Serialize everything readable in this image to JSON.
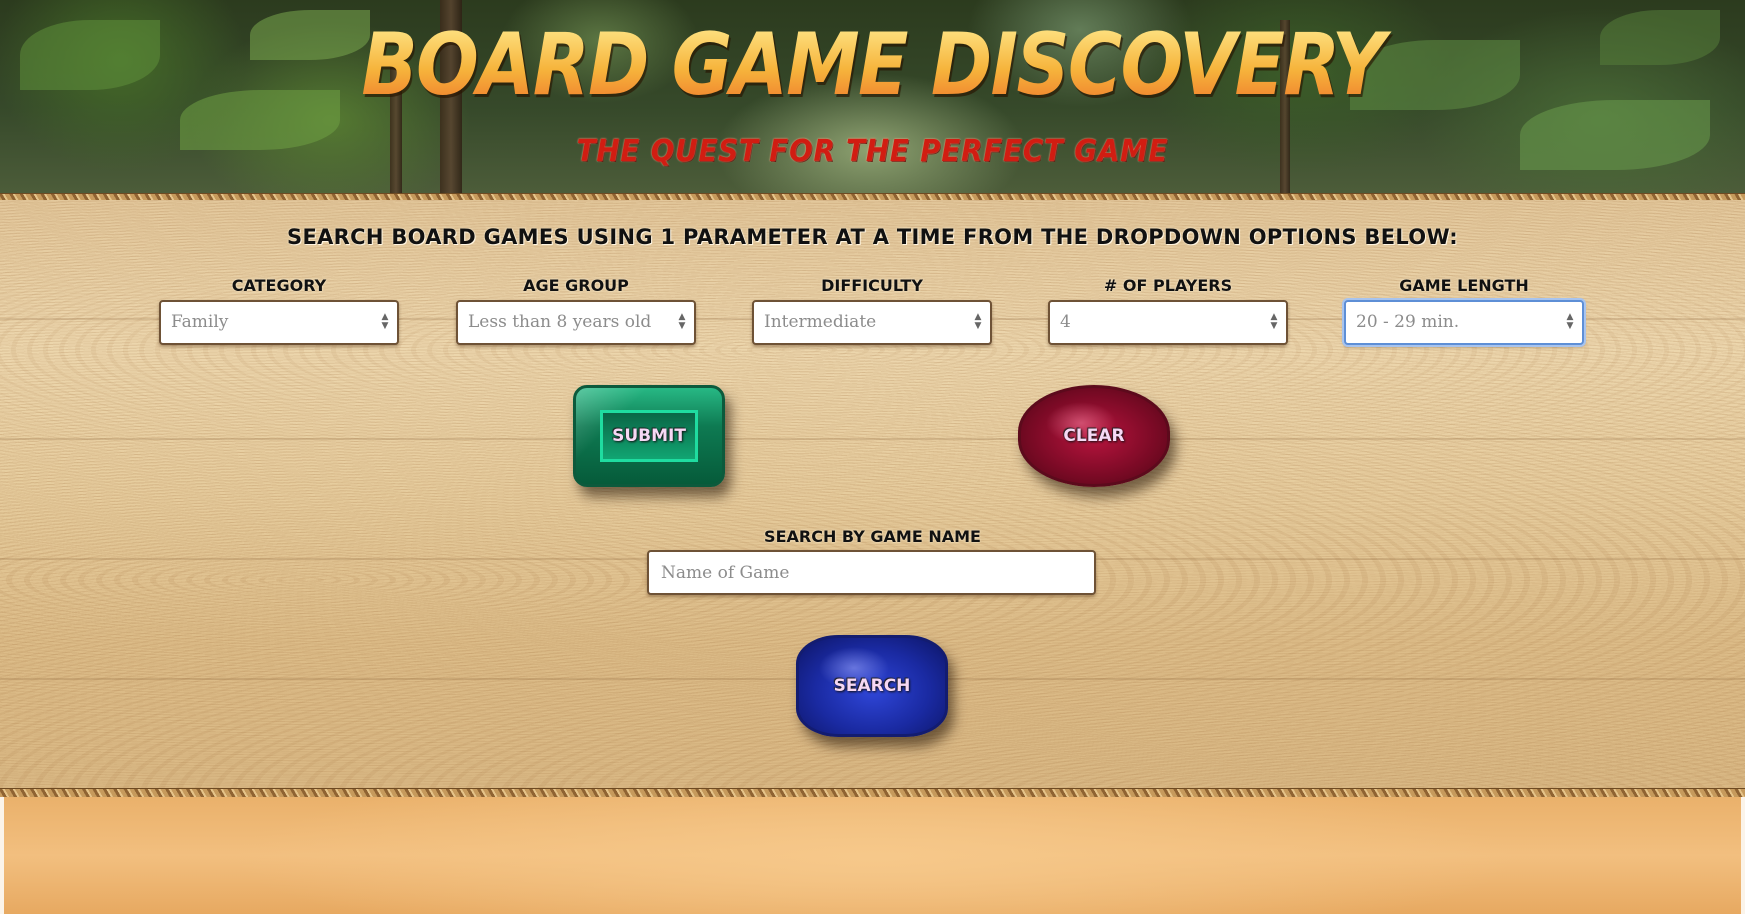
{
  "header": {
    "title": "BOARD GAME DISCOVERY",
    "subtitle": "THE QUEST FOR THE PERFECT GAME"
  },
  "form": {
    "heading": "SEARCH BOARD GAMES USING 1 PARAMETER AT A TIME FROM THE DROPDOWN OPTIONS BELOW:",
    "dropdowns": [
      {
        "label": "CATEGORY",
        "value": "Family"
      },
      {
        "label": "AGE GROUP",
        "value": "Less than 8 years old"
      },
      {
        "label": "DIFFICULTY",
        "value": "Intermediate"
      },
      {
        "label": "# OF PLAYERS",
        "value": "4"
      },
      {
        "label": "GAME LENGTH",
        "value": "20 - 29 min."
      }
    ],
    "submit_label": "SUBMIT",
    "clear_label": "CLEAR",
    "name_search": {
      "label": "SEARCH BY GAME NAME",
      "placeholder": "Name of Game"
    },
    "search_label": "SEARCH"
  },
  "colors": {
    "title_gradient_top": "#ffe88a",
    "title_gradient_bottom": "#ef7a2b",
    "subtitle": "#d11d12",
    "emerald": "#0e7a52",
    "ruby": "#b8143e",
    "sapphire": "#2f46d8",
    "focus_ring": "#5e8fd6"
  }
}
